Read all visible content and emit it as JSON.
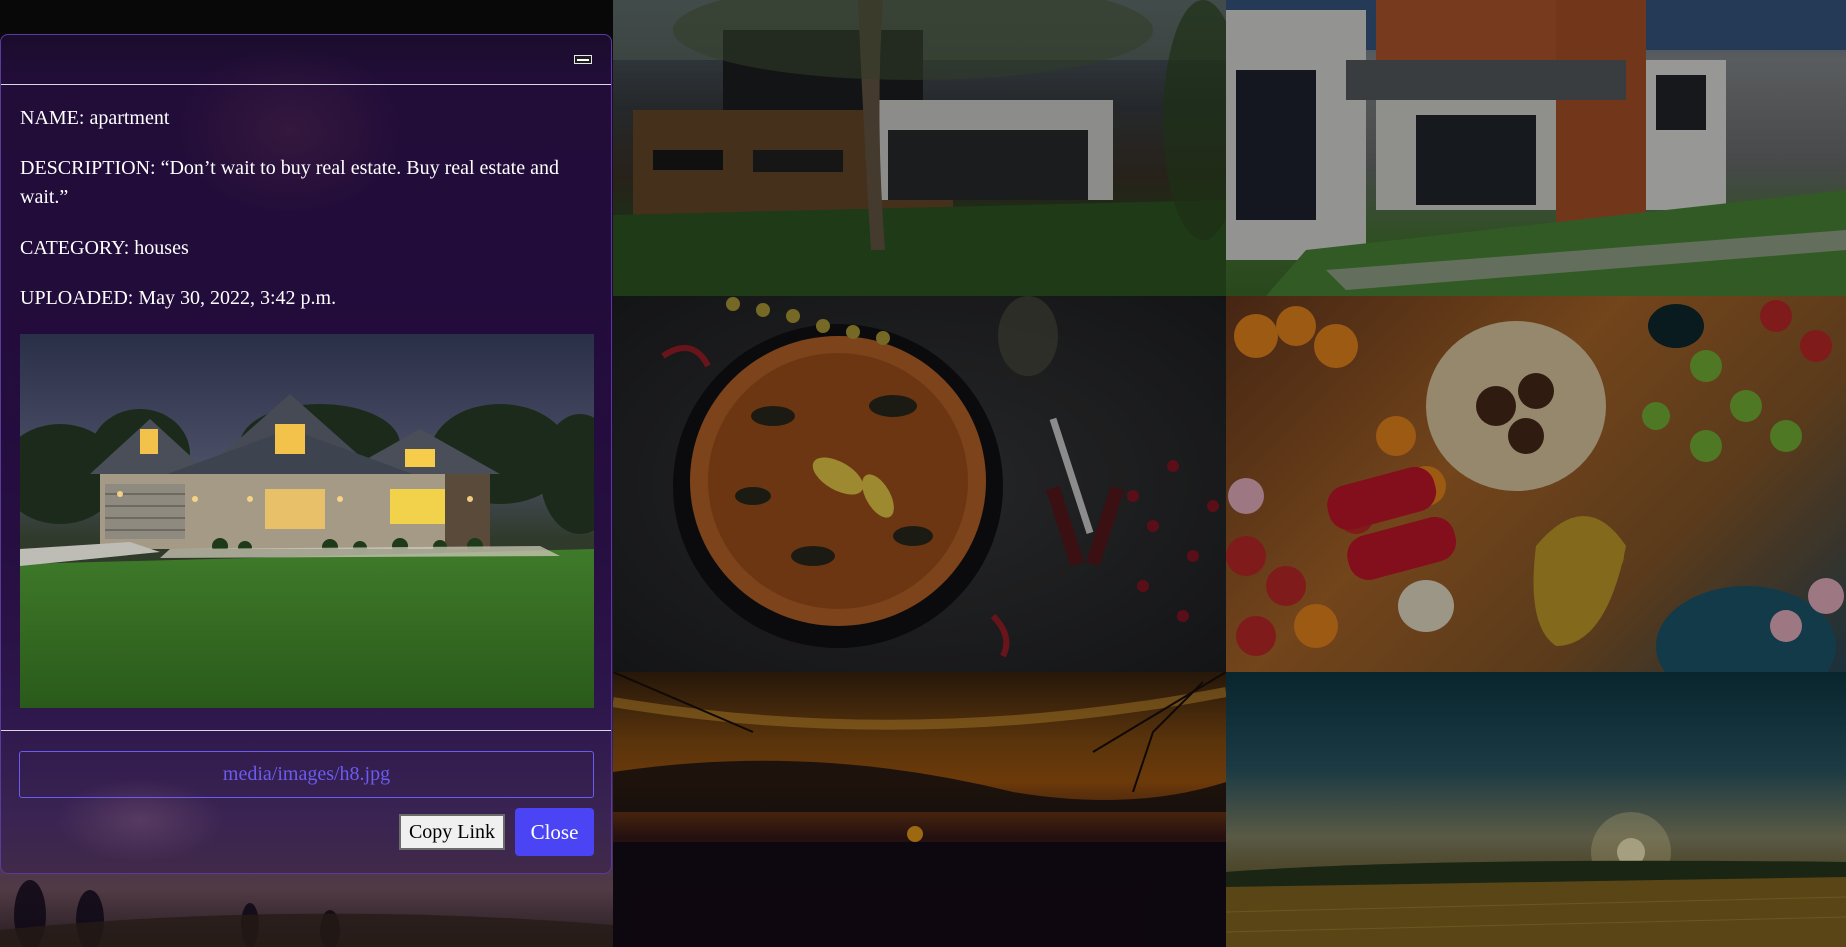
{
  "modal": {
    "name_label": "NAME: apartment",
    "description_label": "DESCRIPTION: “Don’t wait to buy real estate. Buy real estate and wait.”",
    "category_label": "CATEGORY: houses",
    "uploaded_label": "UPLOADED: May 30, 2022, 3:42 p.m.",
    "preview_alt": "apartment",
    "link_value": "media/images/h8.jpg",
    "copy_label": "Copy Link",
    "close_label": "Close",
    "minimize_icon": "minimize-icon"
  },
  "gallery": {
    "tiles": [
      {
        "subject": "sunset-field-behind-modal"
      },
      {
        "subject": "modern-house-with-tree"
      },
      {
        "subject": "modern-house-red-cladding"
      },
      {
        "subject": "paella-pan"
      },
      {
        "subject": "breakfast-feast"
      },
      {
        "subject": "orange-sunset-lake"
      },
      {
        "subject": "sunset-wheat-field"
      }
    ]
  },
  "colors": {
    "accent": "#4a44f5",
    "input_border": "#6a5cf0",
    "modal_border": "#5a3a9a"
  }
}
